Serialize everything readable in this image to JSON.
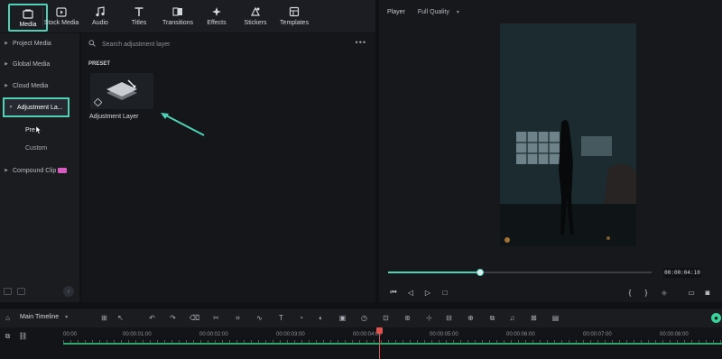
{
  "toolbar": {
    "tools": [
      {
        "label": "Media",
        "icon": "media-icon"
      },
      {
        "label": "Stock Media",
        "icon": "stock-media-icon"
      },
      {
        "label": "Audio",
        "icon": "music-note-icon"
      },
      {
        "label": "Titles",
        "icon": "text-t-icon"
      },
      {
        "label": "Transitions",
        "icon": "transitions-icon"
      },
      {
        "label": "Effects",
        "icon": "sparkle-icon"
      },
      {
        "label": "Stickers",
        "icon": "sticker-icon"
      },
      {
        "label": "Templates",
        "icon": "templates-icon"
      }
    ],
    "active": "Media"
  },
  "sidebar": {
    "items": [
      {
        "label": "Project Media"
      },
      {
        "label": "Global Media"
      },
      {
        "label": "Cloud Media"
      },
      {
        "label": "Adjustment La..."
      },
      {
        "label": "Compound Clip"
      }
    ],
    "sub_items": [
      {
        "label": "Pre"
      },
      {
        "label": "Custom"
      }
    ]
  },
  "content": {
    "search_placeholder": "Search adjustment layer",
    "section_label": "PRESET",
    "asset_label": "Adjustment Layer"
  },
  "player": {
    "label": "Player",
    "quality": "Full Quality",
    "timecode": "00:00:04:10",
    "progress": 0.35
  },
  "timeline": {
    "name": "Main Timeline",
    "ruler_labels": [
      "00:00",
      "00:00:01:00",
      "00:00:02:00",
      "00:00:03:00",
      "00:00:04:00",
      "00:00:05:00",
      "00:00:06:00",
      "00:00:07:00",
      "00:00:08:00"
    ]
  },
  "colors": {
    "accent": "#4fd1b5",
    "playhead": "#e0524d",
    "badge": "#d65dbf"
  }
}
